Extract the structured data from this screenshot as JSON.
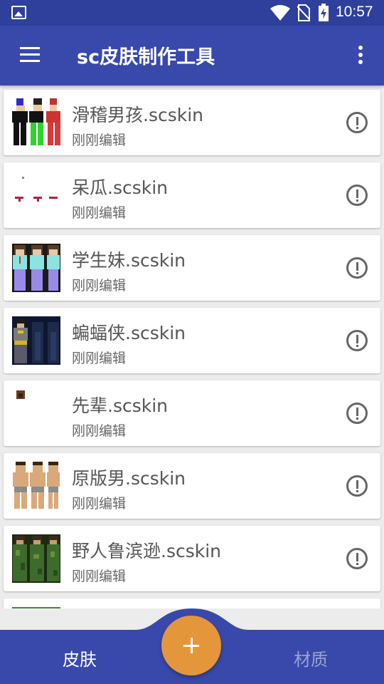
{
  "status_bar": {
    "time": "10:57"
  },
  "app_bar": {
    "title": "sc皮肤制作工具"
  },
  "files": [
    {
      "name": "滑稽男孩.scskin",
      "subtitle": "刚刚编辑",
      "thumb": "skin-funny-boy"
    },
    {
      "name": "呆瓜.scskin",
      "subtitle": "刚刚编辑",
      "thumb": "skin-dummy"
    },
    {
      "name": "学生妹.scskin",
      "subtitle": "刚刚编辑",
      "thumb": "skin-student-girl"
    },
    {
      "name": "蝙蝠侠.scskin",
      "subtitle": "刚刚编辑",
      "thumb": "skin-batman"
    },
    {
      "name": "先辈.scskin",
      "subtitle": "刚刚编辑",
      "thumb": "skin-senior"
    },
    {
      "name": "原版男.scskin",
      "subtitle": "刚刚编辑",
      "thumb": "skin-original-male"
    },
    {
      "name": "野人鲁滨逊.scskin",
      "subtitle": "刚刚编辑",
      "thumb": "skin-robinson"
    }
  ],
  "bottom_nav": {
    "skin_label": "皮肤",
    "material_label": "材质",
    "fab_icon": "plus-icon"
  },
  "colors": {
    "primary": "#3949ab",
    "status_bar": "#2f3f9c",
    "fab": "#e6963a"
  }
}
